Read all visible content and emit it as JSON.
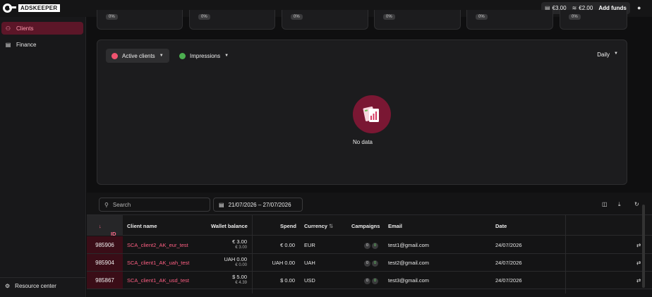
{
  "brand": {
    "logo_text": "ADSKEEPER"
  },
  "header": {
    "wallet_main": "€3.00",
    "wallet_bonus": "€2.00",
    "add_funds_label": "Add funds"
  },
  "sidebar": {
    "items": [
      {
        "label": "Clients",
        "icon": "users-icon",
        "active": true
      },
      {
        "label": "Finance",
        "icon": "finance-chart-icon",
        "active": false
      }
    ],
    "resource_center_label": "Resource center"
  },
  "stat_cards": [
    {
      "value": "0%"
    },
    {
      "value": "0%"
    },
    {
      "value": "0%"
    },
    {
      "value": "0%"
    },
    {
      "value": "0%"
    },
    {
      "value": "0%"
    }
  ],
  "chart": {
    "series_1_label": "Active clients",
    "series_1_color": "#f0536f",
    "series_2_label": "Impressions",
    "series_2_color": "#4caf50",
    "period_label": "Daily",
    "empty_text": "No data"
  },
  "filters": {
    "search_placeholder": "Search",
    "date_range": "21/07/2026 – 27/07/2026"
  },
  "table": {
    "columns": {
      "id": "ID",
      "client_name": "Client name",
      "wallet_balance": "Wallet balance",
      "spend": "Spend",
      "currency": "Currency",
      "campaigns": "Campaigns",
      "email": "Email",
      "date": "Date"
    },
    "rows": [
      {
        "id": "985906",
        "client_name": "SCA_client2_AK_eur_test",
        "balance": "€ 3.00",
        "balance_sub": "€ 3.00",
        "spend": "€ 0.00",
        "currency": "EUR",
        "campaigns_a": "0",
        "campaigns_b": "0",
        "email": "test1@gmail.com",
        "date": "24/07/2026"
      },
      {
        "id": "985904",
        "client_name": "SCA_client1_AK_uah_test",
        "balance": "UAH 0.00",
        "balance_sub": "€ 0.00",
        "spend": "UAH 0.00",
        "currency": "UAH",
        "campaigns_a": "0",
        "campaigns_b": "0",
        "email": "test2@gmail.com",
        "date": "24/07/2026"
      },
      {
        "id": "985867",
        "client_name": "SCA_client1_AK_usd_test",
        "balance": "$ 5.00",
        "balance_sub": "€ 4.39",
        "spend": "$ 0.00",
        "currency": "USD",
        "campaigns_a": "0",
        "campaigns_b": "0",
        "email": "test3@gmail.com",
        "date": "24/07/2026"
      }
    ]
  }
}
